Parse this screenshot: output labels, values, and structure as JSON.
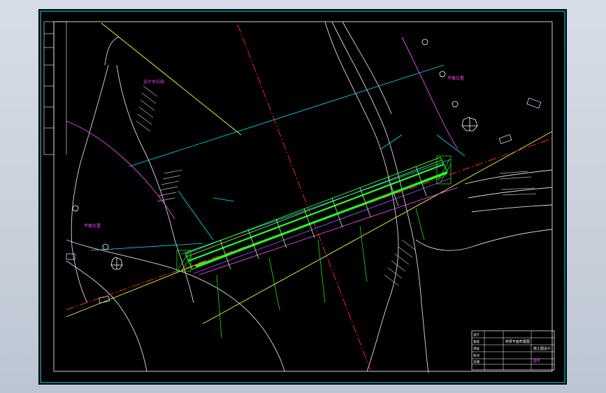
{
  "drawing": {
    "labels": {
      "top_leader": "设计水位线",
      "left_label": "平面位置",
      "right_label": "平面位置"
    },
    "title_block": {
      "title_line1": "桥梁平面布置图",
      "title_line2": "施工图设计",
      "drawing_no": "图号",
      "sheet_rows": [
        "设计",
        "复核",
        "审核",
        "校对",
        "日期"
      ]
    },
    "colors": {
      "frame": "#00e5ff",
      "bridge": "#22ff22",
      "centerline": "#ff2020",
      "contour": "#e0e0e0",
      "magenta": "#ff40ff",
      "yellow": "#e6ff40"
    }
  }
}
